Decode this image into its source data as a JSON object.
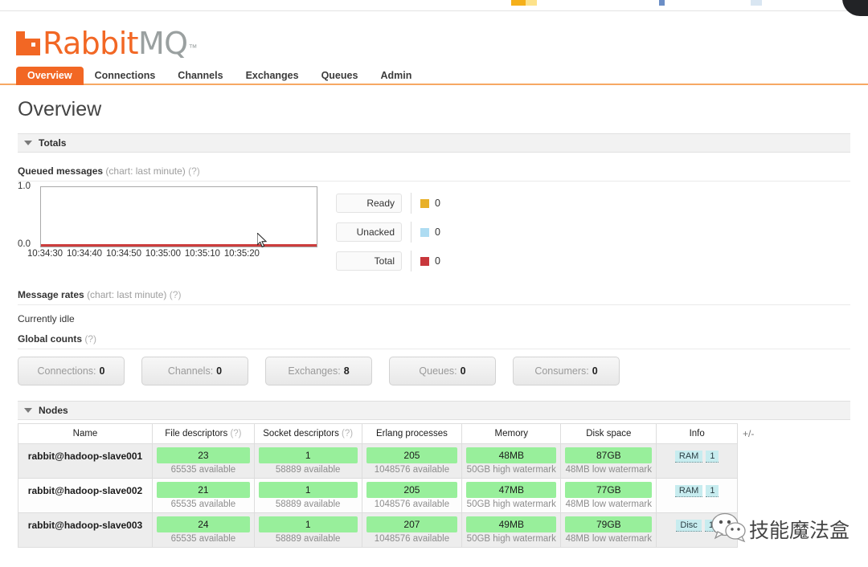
{
  "browser": {
    "corner_icon": "dark-circle"
  },
  "brand": {
    "name_primary": "Rabbit",
    "name_secondary": "MQ",
    "trademark": "™",
    "accent_color": "#f26724",
    "logo_icon": "rabbitmq-logo-icon"
  },
  "nav": {
    "items": [
      {
        "label": "Overview",
        "active": true
      },
      {
        "label": "Connections",
        "active": false
      },
      {
        "label": "Channels",
        "active": false
      },
      {
        "label": "Exchanges",
        "active": false
      },
      {
        "label": "Queues",
        "active": false
      },
      {
        "label": "Admin",
        "active": false
      }
    ]
  },
  "page": {
    "title": "Overview"
  },
  "sections": {
    "totals": {
      "label": "Totals",
      "expanded": true
    },
    "nodes": {
      "label": "Nodes",
      "expanded": true
    }
  },
  "queued_messages": {
    "title": "Queued messages",
    "subtitle": "(chart: last minute)",
    "help": "(?)"
  },
  "message_rates": {
    "title": "Message rates",
    "subtitle": "(chart: last minute)",
    "help": "(?)",
    "status": "Currently idle"
  },
  "global_counts": {
    "title": "Global counts",
    "help": "(?)",
    "items": [
      {
        "label": "Connections:",
        "value": "0"
      },
      {
        "label": "Channels:",
        "value": "0"
      },
      {
        "label": "Exchanges:",
        "value": "8"
      },
      {
        "label": "Queues:",
        "value": "0"
      },
      {
        "label": "Consumers:",
        "value": "0"
      }
    ]
  },
  "chart_data": {
    "type": "line",
    "title": "Queued messages (chart: last minute)",
    "xlabel": "",
    "ylabel": "",
    "ylim": [
      0,
      1
    ],
    "ytick_labels": [
      "0.0",
      "1.0"
    ],
    "x": [
      "10:34:30",
      "10:34:40",
      "10:34:50",
      "10:35:00",
      "10:35:10",
      "10:35:20"
    ],
    "grid": false,
    "legend_position": "right",
    "series": [
      {
        "name": "Ready",
        "color": "#e8b028",
        "values": [
          0,
          0,
          0,
          0,
          0,
          0
        ],
        "current": "0"
      },
      {
        "name": "Unacked",
        "color": "#aedcf2",
        "values": [
          0,
          0,
          0,
          0,
          0,
          0
        ],
        "current": "0"
      },
      {
        "name": "Total",
        "color": "#c8373c",
        "values": [
          0,
          0,
          0,
          0,
          0,
          0
        ],
        "current": "0"
      }
    ]
  },
  "nodes_table": {
    "columns": [
      {
        "label": "Name",
        "help": ""
      },
      {
        "label": "File descriptors",
        "help": "(?)"
      },
      {
        "label": "Socket descriptors",
        "help": "(?)"
      },
      {
        "label": "Erlang processes",
        "help": ""
      },
      {
        "label": "Memory",
        "help": ""
      },
      {
        "label": "Disk space",
        "help": ""
      },
      {
        "label": "Info",
        "help": ""
      }
    ],
    "toggle_columns_label": "+/-",
    "rows": [
      {
        "name": "rabbit@hadoop-slave001",
        "file_descriptors": {
          "value": "23",
          "sub": "65535 available"
        },
        "socket_descriptors": {
          "value": "1",
          "sub": "58889 available"
        },
        "erlang_processes": {
          "value": "205",
          "sub": "1048576 available"
        },
        "memory": {
          "value": "48MB",
          "sub": "50GB high watermark"
        },
        "disk_space": {
          "value": "87GB",
          "sub": "48MB low watermark"
        },
        "info": [
          "RAM",
          "1"
        ]
      },
      {
        "name": "rabbit@hadoop-slave002",
        "file_descriptors": {
          "value": "21",
          "sub": "65535 available"
        },
        "socket_descriptors": {
          "value": "1",
          "sub": "58889 available"
        },
        "erlang_processes": {
          "value": "205",
          "sub": "1048576 available"
        },
        "memory": {
          "value": "47MB",
          "sub": "50GB high watermark"
        },
        "disk_space": {
          "value": "77GB",
          "sub": "48MB low watermark"
        },
        "info": [
          "RAM",
          "1"
        ]
      },
      {
        "name": "rabbit@hadoop-slave003",
        "file_descriptors": {
          "value": "24",
          "sub": "65535 available"
        },
        "socket_descriptors": {
          "value": "1",
          "sub": "58889 available"
        },
        "erlang_processes": {
          "value": "207",
          "sub": "1048576 available"
        },
        "memory": {
          "value": "49MB",
          "sub": "50GB high watermark"
        },
        "disk_space": {
          "value": "79GB",
          "sub": "48MB low watermark"
        },
        "info": [
          "Disc",
          "1"
        ]
      }
    ]
  },
  "watermark": {
    "text": "技能魔法盒",
    "icon": "wechat-icon"
  }
}
